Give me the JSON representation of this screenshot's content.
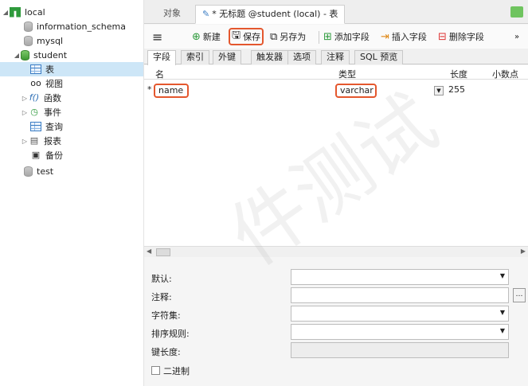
{
  "tree": {
    "connection": "local",
    "databases": [
      "information_schema",
      "mysql"
    ],
    "open_db": "student",
    "children": [
      "表",
      "视图",
      "函数",
      "事件",
      "查询",
      "报表",
      "备份"
    ],
    "last_db": "test"
  },
  "tabs": {
    "objects": "对象",
    "current": "* 无标题 @student (local) - 表"
  },
  "toolbar": {
    "menu": "≡",
    "new": "新建",
    "save": "保存",
    "save_as": "另存为",
    "add_field": "添加字段",
    "insert_field": "插入字段",
    "delete_field": "删除字段"
  },
  "subtabs": [
    "字段",
    "索引",
    "外键",
    "触发器",
    "选项",
    "注释",
    "SQL 预览"
  ],
  "grid": {
    "columns": {
      "name": "名",
      "type": "类型",
      "length": "长度",
      "decimals": "小数点"
    },
    "rows": [
      {
        "marker": "*",
        "name": "name",
        "type": "varchar",
        "length": "255"
      }
    ]
  },
  "props": {
    "default": "默认:",
    "comment": "注释:",
    "charset": "字符集:",
    "collation": "排序规则:",
    "key_length": "键长度:",
    "binary": "二进制"
  },
  "watermark": "件测试",
  "colors": {
    "highlight": "#e4572e",
    "selection": "#cde6f7",
    "green": "#2e9a3c"
  }
}
